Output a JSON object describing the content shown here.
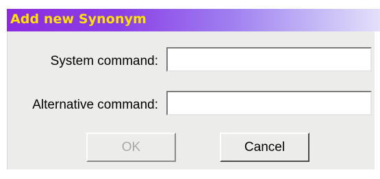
{
  "dialog": {
    "title": "Add new Synonym",
    "colors": {
      "title_text": "#ffe200",
      "title_gradient_start": "#8c2be0",
      "title_gradient_end": "#e4e0fa",
      "panel_background": "#ececea"
    }
  },
  "form": {
    "system_command_label": "System command:",
    "system_command_value": "",
    "alternative_command_label": "Alternative command:",
    "alternative_command_value": ""
  },
  "buttons": {
    "ok_label": "OK",
    "ok_enabled": false,
    "cancel_label": "Cancel"
  }
}
